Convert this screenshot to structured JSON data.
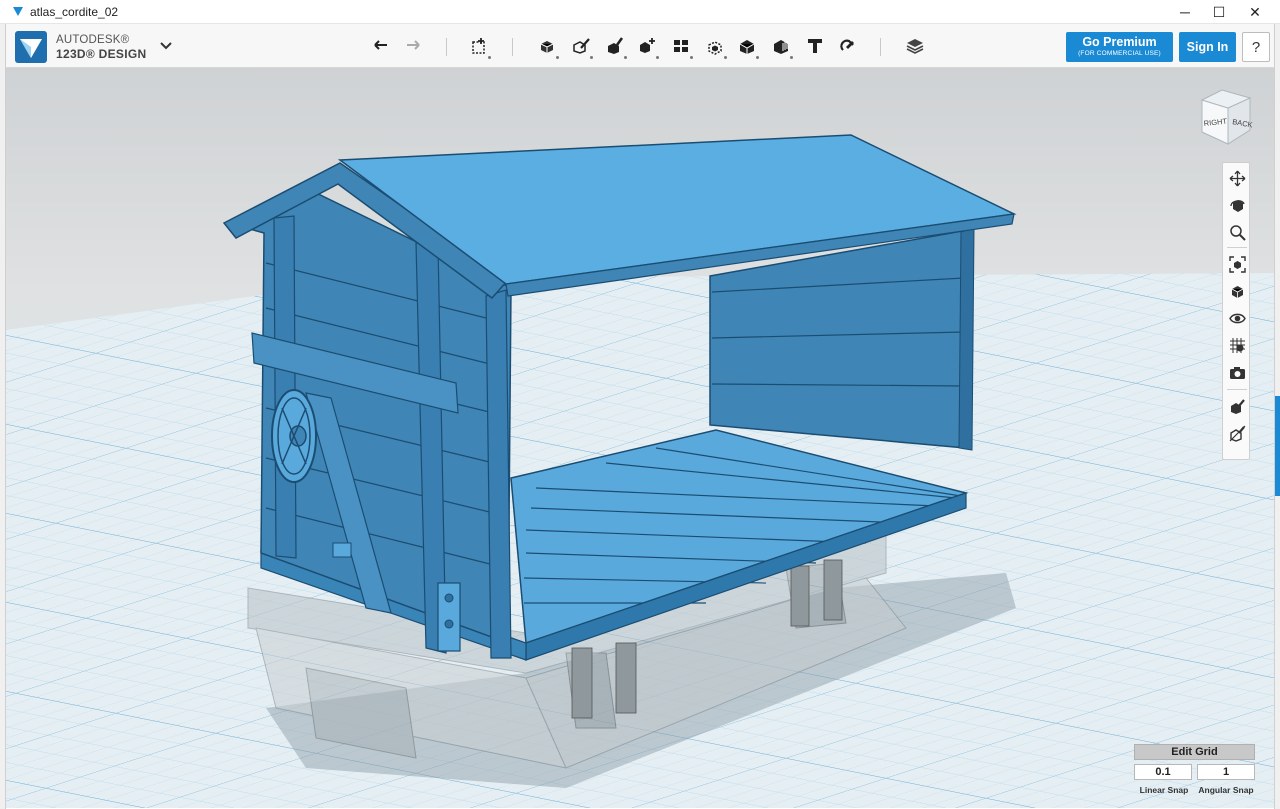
{
  "window": {
    "title": "atlas_cordite_02",
    "minimize_glyph": "─",
    "maximize_glyph": "☐",
    "close_glyph": "✕"
  },
  "brand": {
    "line1": "AUTODESK®",
    "line2": "123D® DESIGN",
    "accent": "#1a8ad4"
  },
  "toolbar": {
    "icons": [
      "undo-icon",
      "redo-icon",
      "primitives-icon",
      "sketch-icon",
      "construct-icon",
      "modify-icon",
      "pattern-icon",
      "grouping-icon",
      "combine-icon",
      "measure-icon",
      "text-icon",
      "snap-icon",
      "material-icon"
    ]
  },
  "account": {
    "premium_label": "Go Premium",
    "premium_sub": "(FOR COMMERCIAL USE)",
    "signin_label": "Sign In",
    "help_label": "?"
  },
  "viewcube": {
    "right_label": "RIGHT",
    "back_label": "BACK"
  },
  "navbar": {
    "icons": [
      "pan-icon",
      "orbit-icon",
      "zoom-icon",
      "fit-icon",
      "view-mode-icon",
      "visibility-icon",
      "grid-toggle-icon",
      "camera-icon",
      "material-toggle-icon",
      "hide-material-icon"
    ]
  },
  "grid": {
    "edit_label": "Edit Grid",
    "linear_value": "0.1",
    "angular_value": "1",
    "linear_label": "Linear Snap",
    "angular_label": "Angular Snap"
  }
}
